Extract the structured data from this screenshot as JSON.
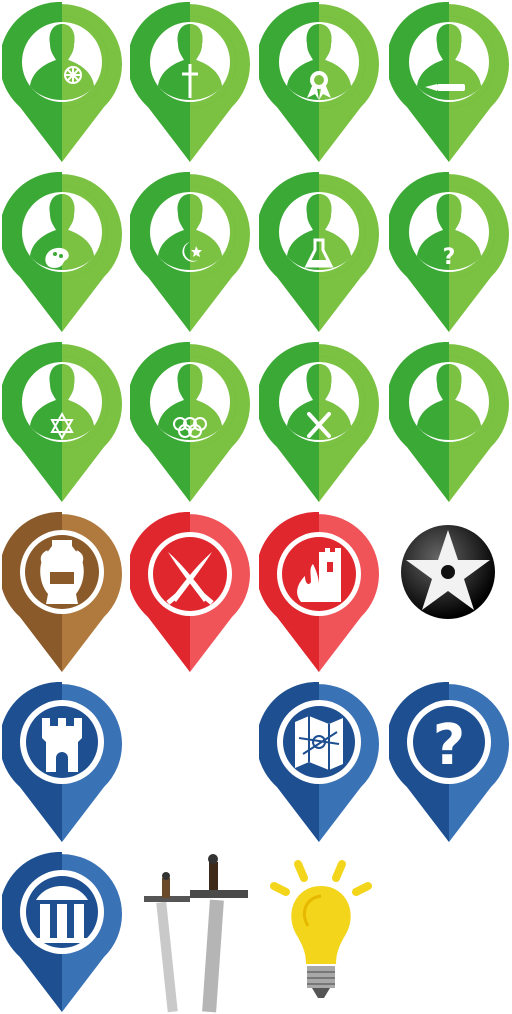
{
  "colors": {
    "green_dark": "#3aa935",
    "green_light": "#7cc242",
    "brown_dark": "#8a5a2b",
    "brown_light": "#b07a3e",
    "red_dark": "#e0272d",
    "red_light": "#f05459",
    "blue_dark": "#1d4f91",
    "blue_light": "#3a72b6",
    "yellow": "#f3d51b"
  },
  "icons": {
    "people": [
      {
        "name": "person-dharma-wheel-marker",
        "symbol": "dharma-wheel"
      },
      {
        "name": "person-cross-marker",
        "symbol": "cross"
      },
      {
        "name": "person-medal-marker",
        "symbol": "medal"
      },
      {
        "name": "person-brush-marker",
        "symbol": "brush"
      },
      {
        "name": "person-palette-marker",
        "symbol": "palette"
      },
      {
        "name": "person-crescent-marker",
        "symbol": "crescent"
      },
      {
        "name": "person-flask-marker",
        "symbol": "flask"
      },
      {
        "name": "person-question-marker",
        "symbol": "question"
      },
      {
        "name": "person-star-of-david-marker",
        "symbol": "star-of-david"
      },
      {
        "name": "person-olympic-rings-marker",
        "symbol": "olympic-rings"
      },
      {
        "name": "person-crossed-swords-marker",
        "symbol": "crossed-swords"
      },
      {
        "name": "person-plain-marker",
        "symbol": "none"
      }
    ],
    "places": [
      {
        "name": "amphora-marker",
        "symbol": "amphora"
      },
      {
        "name": "battle-sabres-marker",
        "symbol": "sabres"
      },
      {
        "name": "burning-tower-marker",
        "symbol": "fire-tower"
      },
      {
        "name": "black-star-circle-icon",
        "symbol": "star"
      },
      {
        "name": "castle-tower-marker",
        "symbol": "tower"
      },
      {
        "name": "map-marker",
        "symbol": "map"
      },
      {
        "name": "question-marker",
        "symbol": "question"
      },
      {
        "name": "temple-marker",
        "symbol": "temple"
      },
      {
        "name": "swords-icon",
        "symbol": "swords"
      },
      {
        "name": "lightbulb-icon",
        "symbol": "bulb"
      }
    ]
  }
}
